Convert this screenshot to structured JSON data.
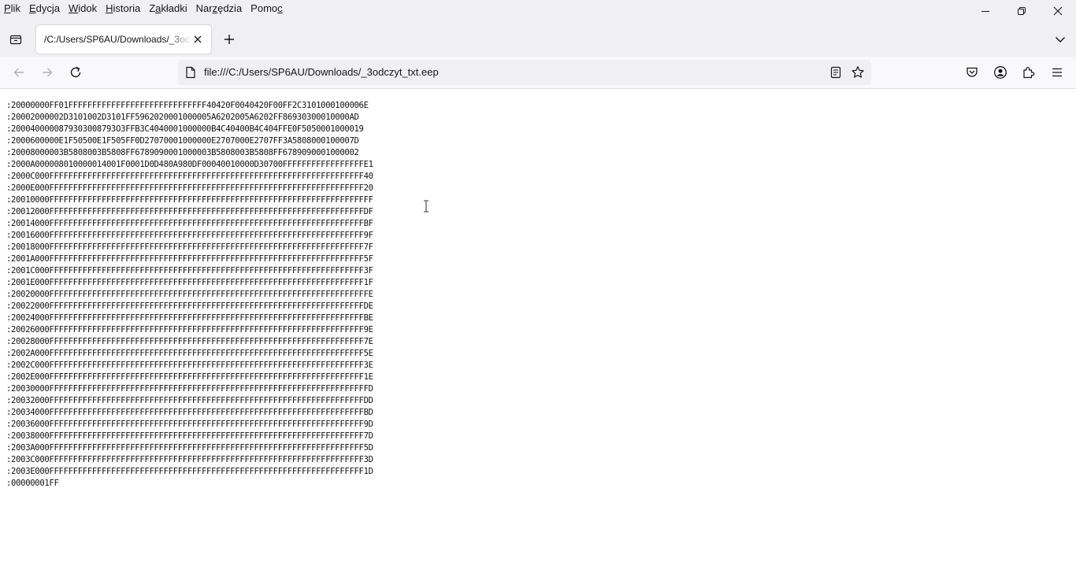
{
  "menubar": {
    "items": [
      {
        "label": "Plik"
      },
      {
        "label": "Edycja"
      },
      {
        "label": "Widok"
      },
      {
        "label": "Historia"
      },
      {
        "label": "Zakładki"
      },
      {
        "label": "Narzędzia"
      },
      {
        "label": "Pomoc"
      }
    ]
  },
  "window_controls": {
    "minimize_icon": "minimize-icon",
    "restore_icon": "restore-icon",
    "close_icon": "close-icon"
  },
  "tabs": [
    {
      "title": "/C:/Users/SP6AU/Downloads/_3odczyt_txt.eep",
      "active": true
    }
  ],
  "toolbar": {
    "url": "file:///C:/Users/SP6AU/Downloads/_3odczyt_txt.eep"
  },
  "content": {
    "lines": [
      ":20000000FF01FFFFFFFFFFFFFFFFFFFFFFFFFFFFF40420F0040420F00FF2C3101000100006E",
      ":20002000002D3101002D3101FF5962020001000005A6202005A6202FF86930300010000AD",
      ":2000400000879303008793O3FFB3C4040001000000B4C40400B4C404FFE0F5050001000019",
      ":2000600000E1F50500E1F505FF0D27070001000000E2707000E2707FF3A5808000100007D",
      ":20008000003B5808003B5808FF6789090001000003B5808003B5808FF6789090001000002",
      ":2000A000008010000014001F0001D0D480A980DF00040010000D30700FFFFFFFFFFFFFFFFFE1",
      ":2000C000FFFFFFFFFFFFFFFFFFFFFFFFFFFFFFFFFFFFFFFFFFFFFFFFFFFFFFFFFFFFFFFFFF40",
      ":2000E000FFFFFFFFFFFFFFFFFFFFFFFFFFFFFFFFFFFFFFFFFFFFFFFFFFFFFFFFFFFFFFFFFF20",
      ":20010000FFFFFFFFFFFFFFFFFFFFFFFFFFFFFFFFFFFFFFFFFFFFFFFFFFFFFFFFFFFFFFFFFFFF",
      ":20012000FFFFFFFFFFFFFFFFFFFFFFFFFFFFFFFFFFFFFFFFFFFFFFFFFFFFFFFFFFFFFFFFFFDF",
      ":20014000FFFFFFFFFFFFFFFFFFFFFFFFFFFFFFFFFFFFFFFFFFFFFFFFFFFFFFFFFFFFFFFFFFBF",
      ":20016000FFFFFFFFFFFFFFFFFFFFFFFFFFFFFFFFFFFFFFFFFFFFFFFFFFFFFFFFFFFFFFFFFF9F",
      ":20018000FFFFFFFFFFFFFFFFFFFFFFFFFFFFFFFFFFFFFFFFFFFFFFFFFFFFFFFFFFFFFFFFFF7F",
      ":2001A000FFFFFFFFFFFFFFFFFFFFFFFFFFFFFFFFFFFFFFFFFFFFFFFFFFFFFFFFFFFFFFFFFF5F",
      ":2001C000FFFFFFFFFFFFFFFFFFFFFFFFFFFFFFFFFFFFFFFFFFFFFFFFFFFFFFFFFFFFFFFFFF3F",
      ":2001E000FFFFFFFFFFFFFFFFFFFFFFFFFFFFFFFFFFFFFFFFFFFFFFFFFFFFFFFFFFFFFFFFFF1F",
      ":20020000FFFFFFFFFFFFFFFFFFFFFFFFFFFFFFFFFFFFFFFFFFFFFFFFFFFFFFFFFFFFFFFFFFFE",
      ":20022000FFFFFFFFFFFFFFFFFFFFFFFFFFFFFFFFFFFFFFFFFFFFFFFFFFFFFFFFFFFFFFFFFFDE",
      ":20024000FFFFFFFFFFFFFFFFFFFFFFFFFFFFFFFFFFFFFFFFFFFFFFFFFFFFFFFFFFFFFFFFFFBE",
      ":20026000FFFFFFFFFFFFFFFFFFFFFFFFFFFFFFFFFFFFFFFFFFFFFFFFFFFFFFFFFFFFFFFFFF9E",
      ":20028000FFFFFFFFFFFFFFFFFFFFFFFFFFFFFFFFFFFFFFFFFFFFFFFFFFFFFFFFFFFFFFFFFF7E",
      ":2002A000FFFFFFFFFFFFFFFFFFFFFFFFFFFFFFFFFFFFFFFFFFFFFFFFFFFFFFFFFFFFFFFFFF5E",
      ":2002C000FFFFFFFFFFFFFFFFFFFFFFFFFFFFFFFFFFFFFFFFFFFFFFFFFFFFFFFFFFFFFFFFFF3E",
      ":2002E000FFFFFFFFFFFFFFFFFFFFFFFFFFFFFFFFFFFFFFFFFFFFFFFFFFFFFFFFFFFFFFFFFF1E",
      ":20030000FFFFFFFFFFFFFFFFFFFFFFFFFFFFFFFFFFFFFFFFFFFFFFFFFFFFFFFFFFFFFFFFFFFD",
      ":20032000FFFFFFFFFFFFFFFFFFFFFFFFFFFFFFFFFFFFFFFFFFFFFFFFFFFFFFFFFFFFFFFFFFDD",
      ":20034000FFFFFFFFFFFFFFFFFFFFFFFFFFFFFFFFFFFFFFFFFFFFFFFFFFFFFFFFFFFFFFFFFFBD",
      ":20036000FFFFFFFFFFFFFFFFFFFFFFFFFFFFFFFFFFFFFFFFFFFFFFFFFFFFFFFFFFFFFFFFFF9D",
      ":20038000FFFFFFFFFFFFFFFFFFFFFFFFFFFFFFFFFFFFFFFFFFFFFFFFFFFFFFFFFFFFFFFFFF7D",
      ":2003A000FFFFFFFFFFFFFFFFFFFFFFFFFFFFFFFFFFFFFFFFFFFFFFFFFFFFFFFFFFFFFFFFFF5D",
      ":2003C000FFFFFFFFFFFFFFFFFFFFFFFFFFFFFFFFFFFFFFFFFFFFFFFFFFFFFFFFFFFFFFFFFF3D",
      ":2003E000FFFFFFFFFFFFFFFFFFFFFFFFFFFFFFFFFFFFFFFFFFFFFFFFFFFFFFFFFFFFFFFFFF1D",
      ":00000001FF"
    ]
  }
}
